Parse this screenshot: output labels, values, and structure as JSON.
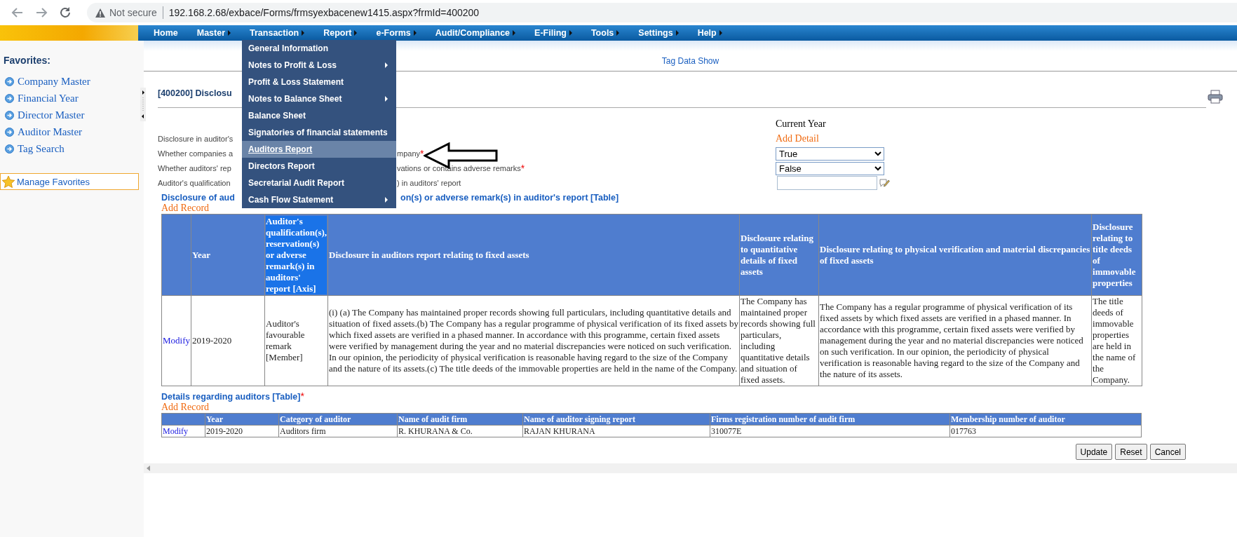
{
  "browser": {
    "security": "Not secure",
    "url": "192.168.2.68/exbace/Forms/frmsyexbacenew1415.aspx?frmId=400200"
  },
  "nav": [
    {
      "label": "Home",
      "has_submenu": false
    },
    {
      "label": "Master",
      "has_submenu": true
    },
    {
      "label": "Transaction",
      "has_submenu": true
    },
    {
      "label": "Report",
      "has_submenu": true
    },
    {
      "label": "e-Forms",
      "has_submenu": true
    },
    {
      "label": "Audit/Compliance",
      "has_submenu": true
    },
    {
      "label": "E-Filing",
      "has_submenu": true
    },
    {
      "label": "Tools",
      "has_submenu": true
    },
    {
      "label": "Settings",
      "has_submenu": true
    },
    {
      "label": "Help",
      "has_submenu": true
    }
  ],
  "open_menu": {
    "items": [
      {
        "label": "General Information",
        "has_submenu": false,
        "selected": false
      },
      {
        "label": "Notes to Profit & Loss",
        "has_submenu": true,
        "selected": false
      },
      {
        "label": "Profit & Loss Statement",
        "has_submenu": false,
        "selected": false
      },
      {
        "label": "Notes to Balance Sheet",
        "has_submenu": true,
        "selected": false
      },
      {
        "label": "Balance Sheet",
        "has_submenu": false,
        "selected": false
      },
      {
        "label": "Signatories of financial statements",
        "has_submenu": false,
        "selected": false
      },
      {
        "label": "Auditors Report",
        "has_submenu": false,
        "selected": true
      },
      {
        "label": "Directors Report",
        "has_submenu": false,
        "selected": false
      },
      {
        "label": "Secretarial Audit Report",
        "has_submenu": false,
        "selected": false
      },
      {
        "label": "Cash Flow Statement",
        "has_submenu": true,
        "selected": false
      }
    ]
  },
  "sidebar": {
    "title": "Favorites:",
    "items": [
      "Company Master",
      "Financial Year",
      "Director Master",
      "Auditor Master",
      "Tag Search"
    ],
    "manage": "Manage Favorites"
  },
  "tag_link": "Tag Data Show",
  "page_title": "[400200] Disclosu",
  "form": {
    "column_heading": "Current Year",
    "add_detail": "Add Detail",
    "rows": [
      {
        "label_start": "Disclosure in auditor's"
      },
      {
        "label_start": "Whether companies a",
        "label_end": "mpany",
        "required_mark": "*",
        "kind": "select",
        "value": "True"
      },
      {
        "label_start": "Whether auditors' rep",
        "label_end": "vations or contains adverse remarks",
        "required_mark": "*",
        "kind": "select",
        "value": "False"
      },
      {
        "label_start": "Auditor's qualification",
        "label_end": ") in auditors' report",
        "kind": "text"
      }
    ]
  },
  "table1": {
    "title_start": "Disclosure of aud",
    "title_end": "on(s) or adverse remark(s) in auditor's report [Table]",
    "add": "Add Record",
    "columns": [
      {
        "label": "Year",
        "highlighted": false
      },
      {
        "label": "Auditor's qualification(s), reservation(s) or adverse remark(s) in auditors' report [Axis]",
        "highlighted": true
      },
      {
        "label": "Disclosure in auditors report relating to fixed assets",
        "highlighted": false
      },
      {
        "label": "Disclosure relating to quantitative details of fixed assets",
        "highlighted": false
      },
      {
        "label": "Disclosure relating to physical verification and material discrepancies of fixed assets",
        "highlighted": false
      },
      {
        "label": "Disclosure relating to title deeds of immovable properties",
        "highlighted": false
      }
    ],
    "rows": [
      {
        "action": "Modify",
        "cells": [
          "2019-2020",
          "Auditor's favourable remark [Member]",
          "(i) (a) The Company has maintained proper records showing full particulars, including quantitative details and situation of fixed assets.(b) The Company has a regular programme of physical verification of its fixed assets by which fixed assets are verified in a phased manner. In accordance with this programme, certain fixed assets were verified by management during the year and no material discrepancies were noticed on such verification. In our opinion, the periodicity of physical verification is reasonable having regard to the size of the Company and the nature of its assets.(c) The title deeds of the immovable properties are held in the name of the Company.",
          "The Company has maintained proper records showing full particulars, including quantitative details and situation of fixed assets.",
          "The Company has a regular programme of physical verification of its fixed assets by which fixed assets are verified in a phased manner. In accordance with this programme, certain fixed assets were verified by management during the year and no material discrepancies were noticed on such verification. In our opinion, the periodicity of physical verification is reasonable having regard to the size of the Company and the nature of its assets.",
          "The title deeds of immovable properties are held in the name of the Company."
        ]
      }
    ]
  },
  "table2": {
    "title": "Details regarding auditors [Table]",
    "required_mark": "*",
    "add": "Add Record",
    "columns": [
      {
        "label": "Year",
        "highlighted": false
      },
      {
        "label": "Category of auditor",
        "highlighted": false
      },
      {
        "label": "Name of audit firm",
        "highlighted": false
      },
      {
        "label": "Name of auditor signing report",
        "highlighted": false
      },
      {
        "label": "Firms registration number of audit firm",
        "highlighted": false
      },
      {
        "label": "Membership number of auditor",
        "highlighted": false
      }
    ],
    "rows": [
      {
        "action": "Modify",
        "cells": [
          "2019-2020",
          "Auditors firm",
          "R. KHURANA & Co.",
          "RAJAN KHURANA",
          "310077E",
          "017763"
        ]
      }
    ]
  },
  "buttons": [
    "Update",
    "Reset",
    "Cancel"
  ]
}
